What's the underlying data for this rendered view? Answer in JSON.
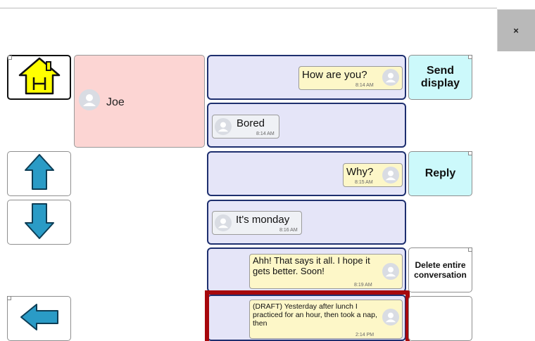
{
  "close_label": "×",
  "contact": {
    "name": "Joe"
  },
  "messages": [
    {
      "text": "How are you?",
      "time": "8:14 AM",
      "direction": "sent"
    },
    {
      "text": "Bored",
      "time": "8:14 AM",
      "direction": "received"
    },
    {
      "text": "Why?",
      "time": "8:15 AM",
      "direction": "sent"
    },
    {
      "text": "It's monday",
      "time": "8:16 AM",
      "direction": "received"
    },
    {
      "text": "Ahh! That says it all. I hope it gets better. Soon!",
      "time": "8:19 AM",
      "direction": "sent"
    },
    {
      "text": "(DRAFT) Yesterday after lunch I practiced for an hour, then took a nap, then",
      "time": "2:14 PM",
      "direction": "sent",
      "draft": true
    }
  ],
  "actions": {
    "send_display": "Send display",
    "reply": "Reply",
    "delete_conversation": "Delete entire conversation"
  },
  "icons": {
    "home": "house-icon",
    "up": "up-arrow-icon",
    "down": "down-arrow-icon",
    "back": "left-arrow-icon"
  },
  "colors": {
    "home_fill": "#ffff00",
    "arrow_fill": "#2a9bc6",
    "contact_bg": "#fcd5d3",
    "row_bg": "#e5e5f8",
    "row_border": "#1e2f6f",
    "sent_bubble": "#fdf7c8",
    "action_cyan": "#ccf9fb",
    "highlight": "#a6070c"
  }
}
